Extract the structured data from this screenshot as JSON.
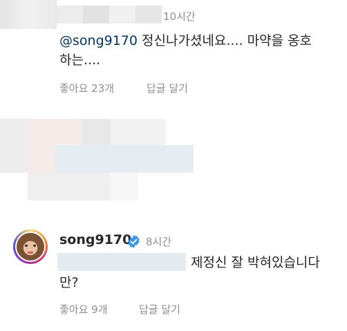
{
  "comment1": {
    "time": "10시간",
    "mention": "@song9170",
    "text_line1": " 정신나가셨네요.... 마약을 옹호",
    "text_line2": "하는....",
    "likes": "좋아요 23개",
    "reply": "답글 달기"
  },
  "comment2": {
    "username": "song9170",
    "verified_icon": "verified-badge-icon",
    "time": "8시간",
    "text_line1": "제정신 잘 박혀있습니다",
    "text_line2": "만?",
    "likes": "좋아요 9개",
    "reply": "답글 달기"
  },
  "colors": {
    "mention": "#00376b",
    "meta": "#8e8e8e",
    "verified": "#3897f0",
    "avatar_ring": [
      "#feda75",
      "#fa7e1e",
      "#d62976",
      "#962fbf"
    ]
  }
}
